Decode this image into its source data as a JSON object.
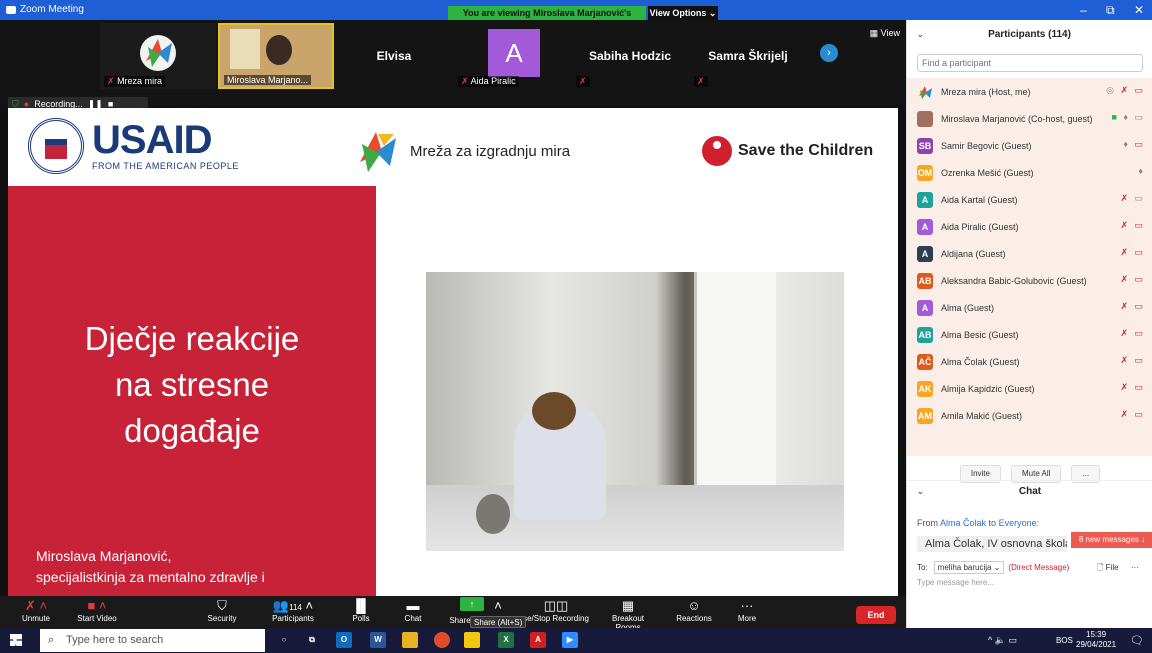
{
  "window": {
    "title": "Zoom Meeting",
    "viewing_banner": "You are viewing Miroslava Marjanović's screen",
    "view_options": "View Options ⌄"
  },
  "strip": {
    "tiles": [
      {
        "name": "Mreza mira"
      },
      {
        "name": "Miroslava Marjano..."
      },
      {
        "name": "Aida Piralic",
        "big": "Elvisa",
        "letter": "A"
      },
      {
        "big2": "Sabiha Hodzic"
      },
      {
        "big3": "Samra Škrijelj"
      }
    ],
    "recording": "Recording...",
    "view_label": "View"
  },
  "slide": {
    "usaid_big": "USAID",
    "usaid_sub": "FROM THE AMERICAN PEOPLE",
    "mreza_text": "Mreža za izgradnju mira",
    "stc_text": "Save the Children",
    "title": "Dječje reakcije\nna stresne\ndogađaje",
    "author_line1": "Miroslava Marjanović,",
    "author_line2": "specijalistkinja za mentalno zdravlje i"
  },
  "toolbar": {
    "unmute": "Unmute",
    "start_video": "Start Video",
    "security": "Security",
    "participants": "Participants",
    "participants_count": "114",
    "polls": "Polls",
    "chat": "Chat",
    "share": "Share",
    "share_tooltip": "Share (Alt+S)",
    "record": "se/Stop Recording",
    "breakout": "Breakout Rooms",
    "reactions": "Reactions",
    "more": "More",
    "end": "End"
  },
  "participants": {
    "title": "Participants (114)",
    "search_placeholder": "Find a participant",
    "list": [
      {
        "initials": "",
        "color": "#ffffff",
        "name": "Mreza mira (Host, me)"
      },
      {
        "initials": "",
        "color": "#a07060",
        "name": "Miroslava Marjanović (Co-host, guest)"
      },
      {
        "initials": "SB",
        "color": "#8e44ad",
        "name": "Samir Begovic (Guest)"
      },
      {
        "initials": "OM",
        "color": "#f5a623",
        "name": "Ozrenka Mešić (Guest)"
      },
      {
        "initials": "A",
        "color": "#1ba39c",
        "name": "Aida Kartal (Guest)"
      },
      {
        "initials": "A",
        "color": "#a25ad9",
        "name": "Aida Piralic (Guest)"
      },
      {
        "initials": "A",
        "color": "#2c3e50",
        "name": "Aldijana (Guest)"
      },
      {
        "initials": "AB",
        "color": "#e05a1c",
        "name": "Aleksandra Babic-Golubovic (Guest)"
      },
      {
        "initials": "A",
        "color": "#a25ad9",
        "name": "Alma (Guest)"
      },
      {
        "initials": "AB",
        "color": "#1ba39c",
        "name": "Alma Besic (Guest)"
      },
      {
        "initials": "AČ",
        "color": "#e05a1c",
        "name": "Alma Čolak (Guest)"
      },
      {
        "initials": "AK",
        "color": "#f5a623",
        "name": "Almija Kapidzic (Guest)"
      },
      {
        "initials": "AM",
        "color": "#f5a623",
        "name": "Amila Makić (Guest)"
      }
    ],
    "invite": "Invite",
    "mute_all": "Mute All",
    "more": "..."
  },
  "chat": {
    "title": "Chat",
    "from_label": "From",
    "from_name": "Alma Čolak",
    "to_label": "to",
    "to_name": "Everyone:",
    "message": "Alma Čolak, IV osnovna škola M",
    "new_messages": "8 new messages ↓",
    "to_prefix": "To:",
    "recipient": "meliha barucija ⌄",
    "direct": "(Direct Message)",
    "file": "File",
    "placeholder": "Type message here..."
  },
  "taskbar": {
    "search": "Type here to search",
    "lang": "BOS",
    "time": "15:39",
    "date": "29/04/2021"
  }
}
